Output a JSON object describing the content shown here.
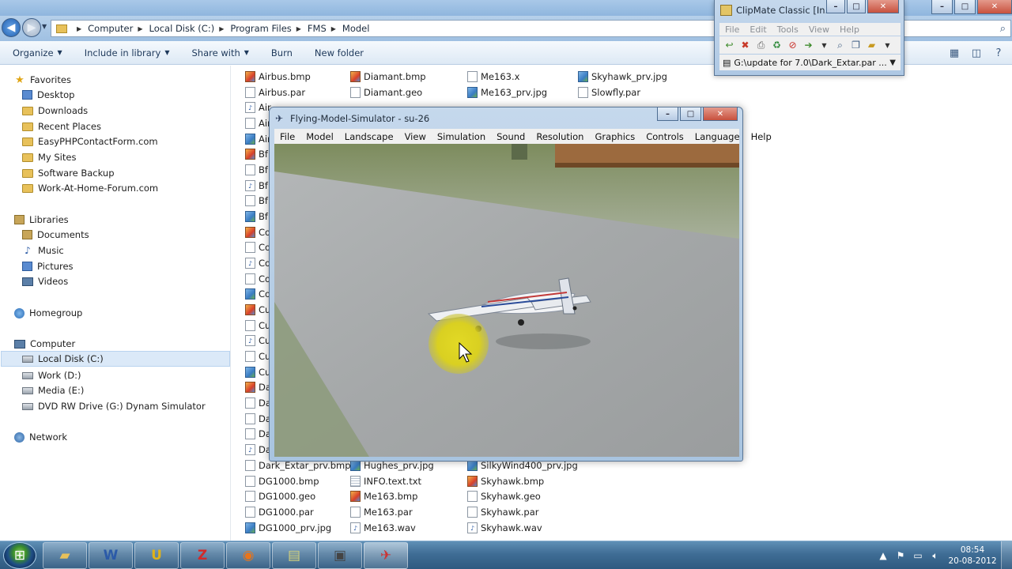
{
  "explorer": {
    "address": {
      "crumbs": [
        "Computer",
        "Local Disk (C:)",
        "Program Files",
        "FMS",
        "Model"
      ]
    },
    "toolbar": {
      "organize": "Organize",
      "include": "Include in library",
      "share": "Share with",
      "burn": "Burn",
      "new_folder": "New folder"
    },
    "nav": {
      "favorites": "Favorites",
      "desktop": "Desktop",
      "downloads": "Downloads",
      "recent": "Recent Places",
      "easyphp": "EasyPHPContactForm.com",
      "mysites": "My Sites",
      "software": "Software Backup",
      "workathome": "Work-At-Home-Forum.com",
      "libraries": "Libraries",
      "documents": "Documents",
      "music": "Music",
      "pictures": "Pictures",
      "videos": "Videos",
      "homegroup": "Homegroup",
      "computer": "Computer",
      "localdisk": "Local Disk (C:)",
      "work": "Work (D:)",
      "media": "Media (E:)",
      "dvd": "DVD RW Drive (G:) Dynam Simulator",
      "network": "Network"
    },
    "files": {
      "col1_top": [
        "Airbus.bmp",
        "Airbus.par",
        "Air",
        "Air",
        "Air",
        "Bf1",
        "Bf1",
        "Bf1",
        "Bf1",
        "Bf1",
        "Co",
        "Co",
        "Co",
        "Co",
        "Co",
        "Cu",
        "Cu",
        "Cu",
        "Cu",
        "Cu",
        "Da",
        "Da",
        "Da",
        "Da",
        "Da"
      ],
      "col1_bottom": [
        "Dark_Extar_prv.bmp",
        "DG1000.bmp",
        "DG1000.geo",
        "DG1000.par",
        "DG1000_prv.jpg"
      ],
      "col2_top": [
        "Diamant.bmp",
        "Diamant.geo"
      ],
      "col2_bottom": [
        "Hughes_prv.jpg",
        "INFO.text.txt",
        "Me163.bmp",
        "Me163.par",
        "Me163.wav"
      ],
      "col3_top": [
        "Me163.x",
        "Me163_prv.jpg"
      ],
      "col3_bottom": [
        "SilkyWind400_prv.jpg",
        "Skyhawk.bmp",
        "Skyhawk.geo",
        "Skyhawk.par",
        "Skyhawk.wav"
      ],
      "col4_top": [
        "Skyhawk_prv.jpg",
        "Slowfly.par"
      ]
    }
  },
  "fms": {
    "title": "Flying-Model-Simulator - su-26",
    "menu": [
      "File",
      "Model",
      "Landscape",
      "View",
      "Simulation",
      "Sound",
      "Resolution",
      "Graphics",
      "Controls",
      "Language",
      "Help"
    ]
  },
  "clipmate": {
    "title": "ClipMate Classic [In...",
    "menu": [
      "File",
      "Edit",
      "Tools",
      "View",
      "Help"
    ],
    "path": "G:\\update for 7.0\\Dark_Extar.par ..."
  },
  "taskbar": {
    "time": "08:54",
    "date": "20-08-2012"
  },
  "colors": {
    "title_bar": "#9fc0e2",
    "taskbar": "#3f6d95",
    "highlight_yellow": "#e6dc1e"
  }
}
